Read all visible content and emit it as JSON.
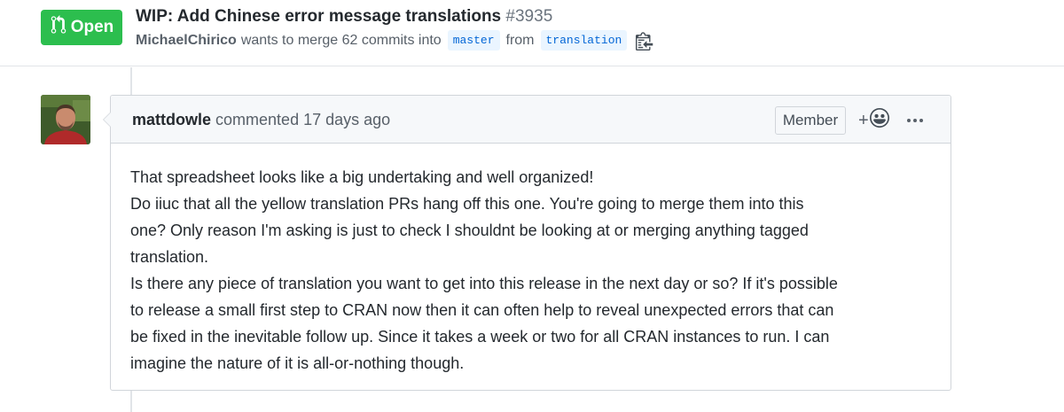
{
  "pr": {
    "state": "Open",
    "title": "WIP: Add Chinese error message translations",
    "number": "#3935",
    "author": "MichaelChirico",
    "merge_text": "wants to merge 62 commits into",
    "base_branch": "master",
    "from_text": "from",
    "head_branch": "translation",
    "icons": {
      "state": "git-pull-request-icon",
      "copy": "clippy-icon"
    }
  },
  "comment": {
    "author": "mattdowle",
    "action": "commented",
    "time": "17 days ago",
    "role": "Member",
    "reaction_plus": "+",
    "icons": {
      "reaction": "smiley-icon",
      "more": "kebab-horizontal-icon"
    },
    "lines": [
      "That spreadsheet looks like a big undertaking and well organized!",
      "Do iiuc that all the yellow translation PRs hang off this one. You're going to merge them into this",
      "one? Only reason I'm asking is just to check I shouldnt be looking at or merging anything tagged",
      "translation.",
      "Is there any piece of translation you want to get into this release in the next day or so? If it's possible",
      "to release a small first step to CRAN now then it can often help to reveal unexpected errors that can",
      "be fixed in the inevitable follow up. Since it takes a week or two for all CRAN instances to run. I can",
      "imagine the nature of it is all-or-nothing though."
    ]
  },
  "colors": {
    "open_badge": "#2cbe4e",
    "branch_bg": "#eaf5ff",
    "branch_text": "#0366d6",
    "border": "#d1d5da",
    "header_bg": "#f6f8fa"
  }
}
